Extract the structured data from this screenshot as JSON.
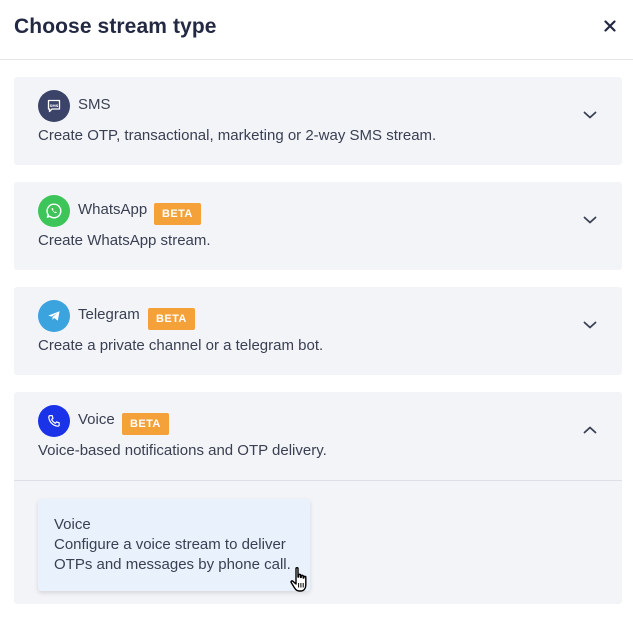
{
  "dialog": {
    "title": "Choose stream type",
    "close_label": "×"
  },
  "options": [
    {
      "name": "SMS",
      "description": "Create OTP, transactional, marketing or 2-way SMS stream.",
      "badge": "",
      "icon": "sms-icon",
      "color": "#3b4468",
      "expanded": false
    },
    {
      "name": "WhatsApp",
      "description": "Create WhatsApp stream.",
      "badge": "BETA",
      "icon": "whatsapp-icon",
      "color": "#3ec55a",
      "expanded": false
    },
    {
      "name": "Telegram",
      "description": "Create a private channel or a telegram bot.",
      "badge": "BETA",
      "icon": "telegram-icon",
      "color": "#3ba3dd",
      "expanded": false
    },
    {
      "name": "Voice",
      "description": "Voice-based notifications and OTP delivery.",
      "badge": "BETA",
      "icon": "phone-icon",
      "color": "#1a33e8",
      "expanded": true,
      "sub_option": {
        "title": "Voice",
        "description_line1": "Configure a voice stream to deliver",
        "description_line2": "OTPs and messages by phone call."
      }
    }
  ],
  "badge_color": "#f5a13a"
}
